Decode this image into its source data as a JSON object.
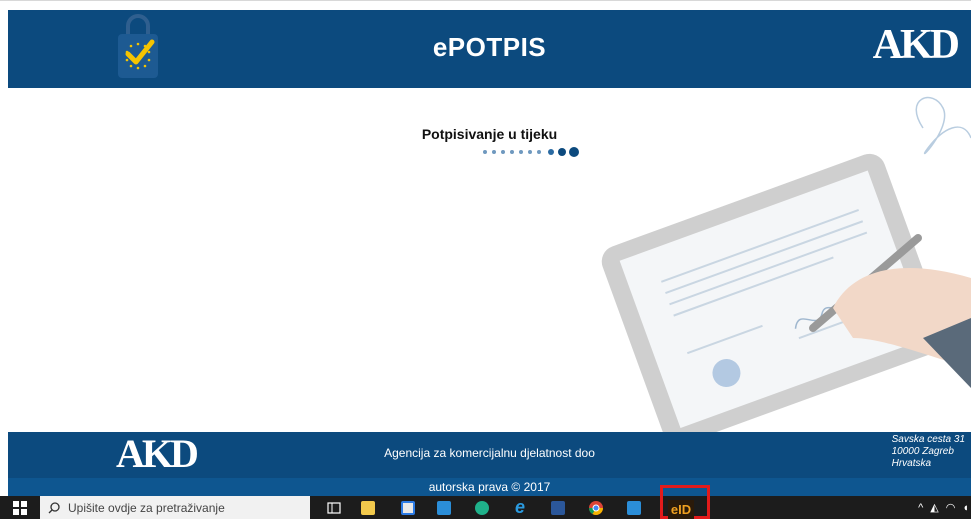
{
  "header": {
    "title": "ePOTPIS",
    "brand_logo": "AKD"
  },
  "main": {
    "progress_label": "Potpisivanje u tijeku",
    "progress_dots": 10
  },
  "footer": {
    "brand_logo": "AKD",
    "company": "Agencija za komercijalnu djelatnost doo",
    "address": [
      "Savska cesta 31",
      "10000 Zagreb",
      "Hrvatska"
    ],
    "copyright": "autorska prava © 2017"
  },
  "taskbar": {
    "search_placeholder": "Upišite ovdje za pretraživanje",
    "apps": [
      "task-view-icon",
      "file-explorer-icon",
      "store-icon",
      "mail-icon",
      "edge-icon",
      "internet-explorer-icon",
      "word-icon",
      "chrome-icon",
      "photos-icon",
      "eid-icon"
    ],
    "eid_label": "eID"
  },
  "colors": {
    "header_bg": "#0c4a7e",
    "copyright_bg": "#0e5690",
    "taskbar_bg": "#1c1c1c",
    "highlight": "#e21b1b",
    "dot_active": "#0c4a7e",
    "dot_inactive": "#6f99bf"
  }
}
